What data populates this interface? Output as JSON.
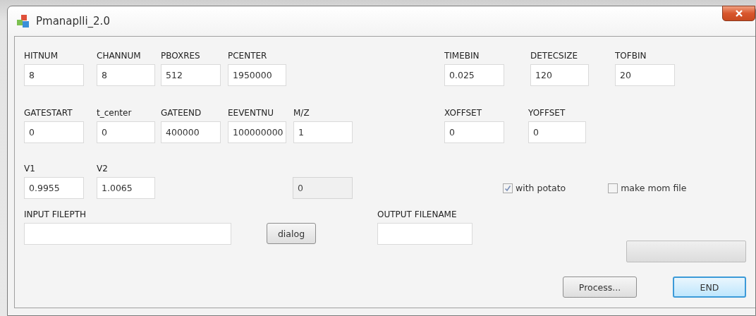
{
  "window": {
    "title": "Pmanaplli_2.0"
  },
  "parameter_rows": [
    [
      {
        "label": "HITNUM",
        "value": "8"
      },
      {
        "label": "CHANNUM",
        "value": "8"
      },
      {
        "label": "PBOXRES",
        "value": "512"
      },
      {
        "label": "PCENTER",
        "value": "1950000"
      },
      {
        "label": "TIMEBIN",
        "value": "0.025"
      },
      {
        "label": "DETECSIZE",
        "value": "120"
      },
      {
        "label": "TOFBIN",
        "value": "20"
      }
    ],
    [
      {
        "label": "GATESTART",
        "value": "0"
      },
      {
        "label": "t_center",
        "value": "0"
      },
      {
        "label": "GATEEND",
        "value": "400000"
      },
      {
        "label": "EEVENTNU",
        "value": "100000000"
      },
      {
        "label": "M/Z",
        "value": "1"
      },
      {
        "label": "XOFFSET",
        "value": "0"
      },
      {
        "label": "YOFFSET",
        "value": "0"
      }
    ],
    [
      {
        "label": "V1",
        "value": "0.9955"
      },
      {
        "label": "V2",
        "value": "1.0065"
      }
    ]
  ],
  "status_field": {
    "value": "0",
    "disabled": true
  },
  "checkboxes": [
    {
      "label": "with potato",
      "checked": true
    },
    {
      "label": "make mom file",
      "checked": false
    }
  ],
  "input_filepath": {
    "label": "INPUT FILEPTH"
  },
  "dialog_button": "dialog",
  "output_filename": {
    "label": "OUTPUT FILENAME"
  },
  "progress": {
    "level": 0
  },
  "buttons": [
    {
      "label": "Process...",
      "default": false
    },
    {
      "label": "END",
      "default": true
    }
  ]
}
